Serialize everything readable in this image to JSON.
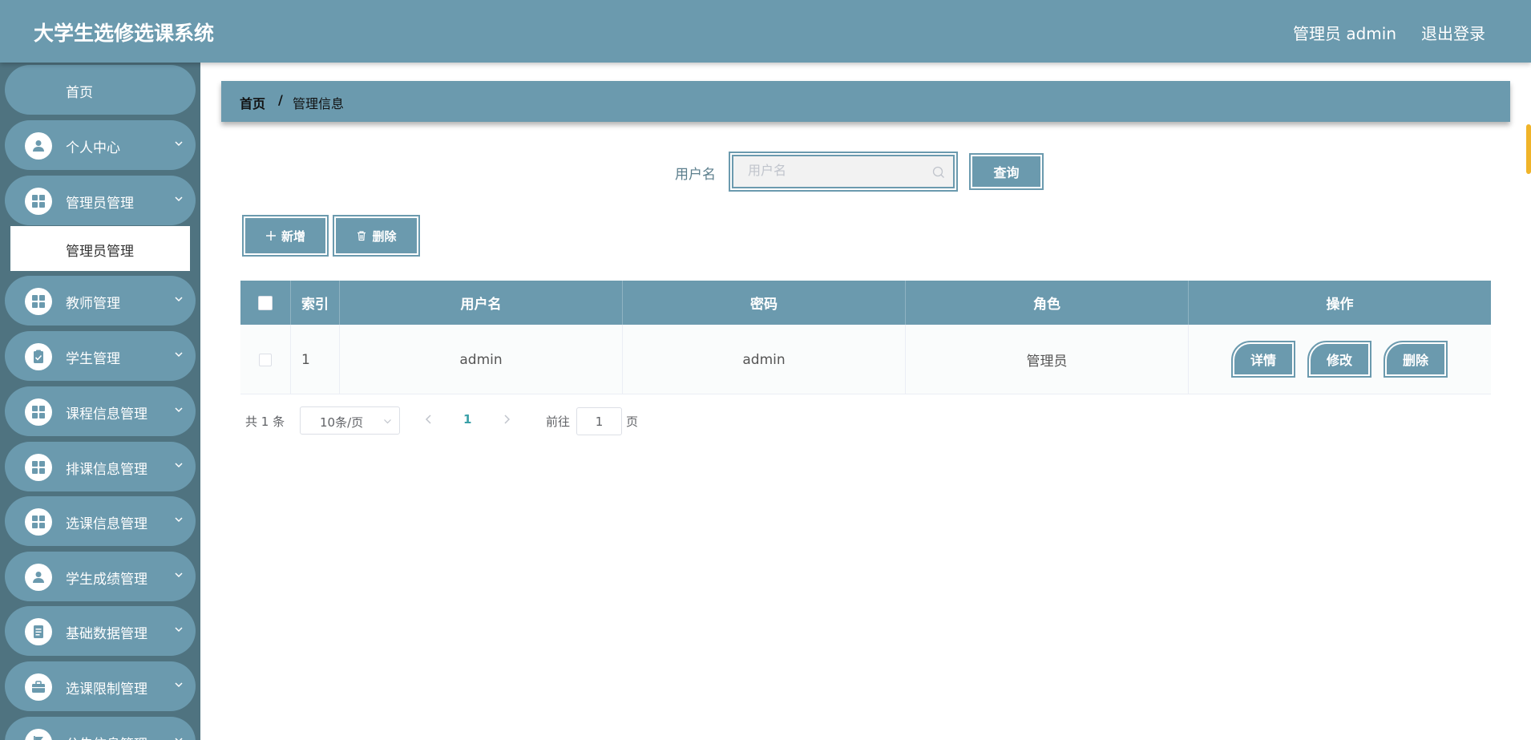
{
  "header": {
    "title": "大学生选修选课系统",
    "user": "管理员 admin",
    "logout": "退出登录"
  },
  "sidebar": {
    "home": "首页",
    "items": [
      {
        "label": "个人中心",
        "icon": "user-icon"
      },
      {
        "label": "管理员管理",
        "icon": "grid-icon"
      },
      {
        "label": "教师管理",
        "icon": "grid-icon"
      },
      {
        "label": "学生管理",
        "icon": "clipboard-check-icon"
      },
      {
        "label": "课程信息管理",
        "icon": "grid-icon"
      },
      {
        "label": "排课信息管理",
        "icon": "grid-icon"
      },
      {
        "label": "选课信息管理",
        "icon": "grid-icon"
      },
      {
        "label": "学生成绩管理",
        "icon": "user-icon"
      },
      {
        "label": "基础数据管理",
        "icon": "document-icon"
      },
      {
        "label": "选课限制管理",
        "icon": "briefcase-icon"
      },
      {
        "label": "公告信息管理",
        "icon": "flag-icon"
      }
    ],
    "submenu": {
      "label": "管理员管理"
    }
  },
  "breadcrumb": {
    "home": "首页",
    "separator": "/",
    "current": "管理信息"
  },
  "search": {
    "label": "用户名",
    "placeholder": "用户名",
    "value": "",
    "button": "查询"
  },
  "actions": {
    "add": "新增",
    "delete": "删除"
  },
  "table": {
    "headers": [
      "索引",
      "用户名",
      "密码",
      "角色",
      "操作"
    ],
    "rows": [
      {
        "index": "1",
        "username": "admin",
        "password": "admin",
        "role": "管理员"
      }
    ],
    "row_actions": {
      "detail": "详情",
      "edit": "修改",
      "delete": "删除"
    }
  },
  "pagination": {
    "total": "共 1 条",
    "page_size": "10条/页",
    "current_page": "1",
    "goto_label": "前往",
    "goto_value": "1",
    "page_suffix": "页"
  },
  "colors": {
    "primary": "#6b9aae",
    "sidebar_bg": "#4f7380",
    "accent": "#3aa0a8"
  }
}
